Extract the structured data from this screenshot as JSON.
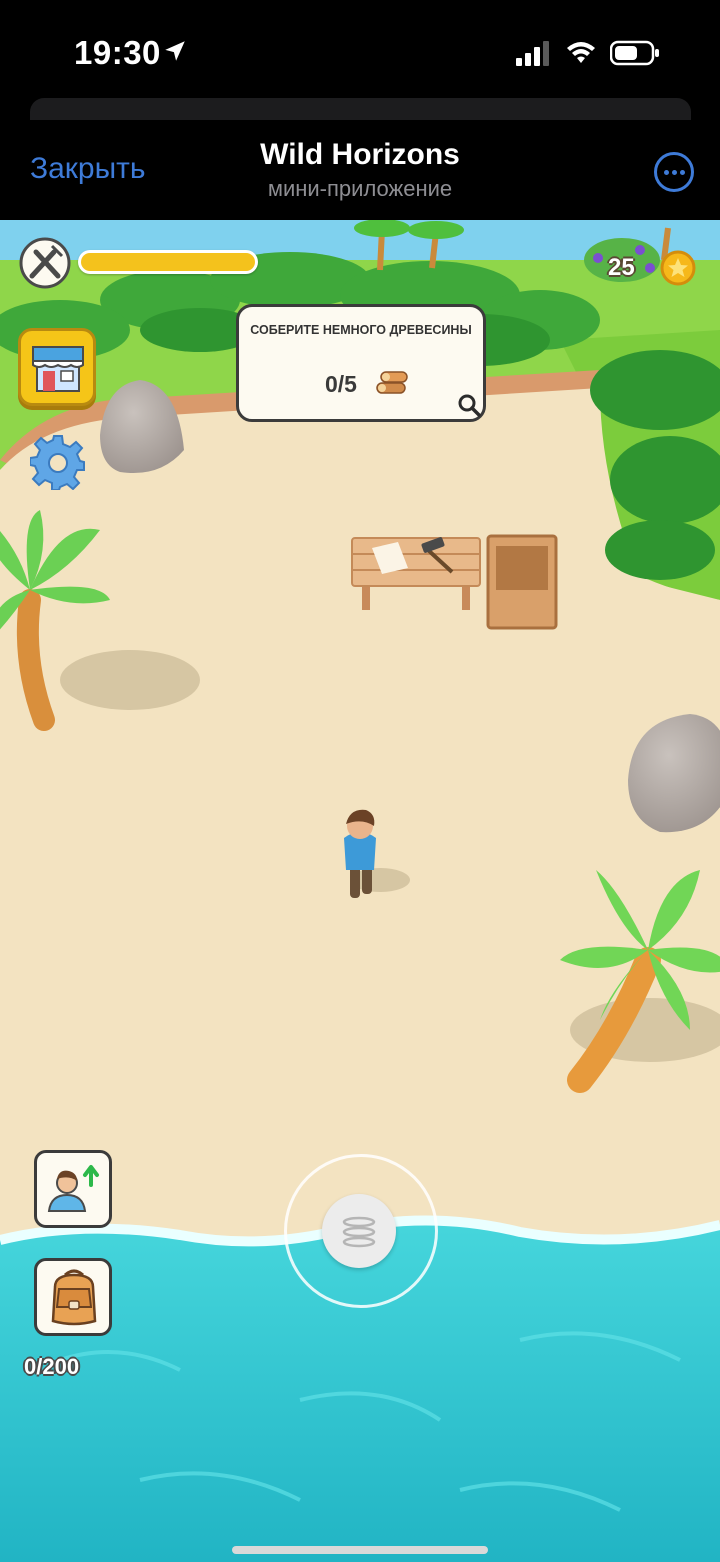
{
  "status_bar": {
    "time": "19:30",
    "icons": [
      "location-arrow-icon",
      "cellular-signal-icon",
      "wifi-icon",
      "battery-icon"
    ]
  },
  "header": {
    "close_label": "Закрыть",
    "title": "Wild Horizons",
    "subtitle": "мини-приложение",
    "menu_icon": "more-icon",
    "accent_color": "#3e7bd8"
  },
  "hud": {
    "hunger_icon": "fork-knife-icon",
    "hunger_level": 1.0,
    "hunger_color": "#f4c21c",
    "coins": "25",
    "coin_icon": "star-coin-icon"
  },
  "side_buttons": {
    "shop_icon": "shop-icon",
    "settings_icon": "gear-icon",
    "profile_icon": "profile-upgrade-icon",
    "backpack_icon": "backpack-icon",
    "backpack_capacity": "0/200"
  },
  "quest": {
    "title": "СОБЕРИТЕ НЕМНОГО ДРЕВЕСИНЫ",
    "progress": "0/5",
    "resource_icon": "wood-logs-icon",
    "action_icon": "magnifier-icon"
  },
  "controls": {
    "joystick_icon": "joystick-icon"
  },
  "scene": {
    "sand_color": "#f3e3c1",
    "water_color": "#2cc4cf",
    "grass_color": "#8fd64a"
  }
}
